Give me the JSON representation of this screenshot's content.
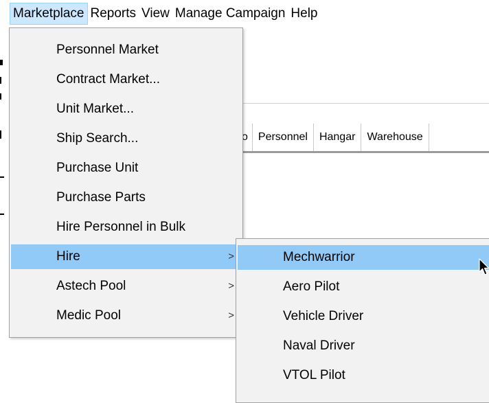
{
  "menubar": {
    "items": [
      {
        "label": "Marketplace",
        "active": true
      },
      {
        "label": "Reports"
      },
      {
        "label": "View"
      },
      {
        "label": "Manage Campaign"
      },
      {
        "label": "Help"
      }
    ]
  },
  "background": {
    "tabs": [
      {
        "label": "o"
      },
      {
        "label": "Personnel"
      },
      {
        "label": "Hangar"
      },
      {
        "label": "Warehouse"
      }
    ]
  },
  "marketplace_menu": {
    "items": [
      {
        "label": "Personnel Market"
      },
      {
        "label": "Contract Market..."
      },
      {
        "label": "Unit Market..."
      },
      {
        "label": "Ship Search..."
      },
      {
        "label": "Purchase Unit"
      },
      {
        "label": "Purchase Parts"
      },
      {
        "label": "Hire Personnel in Bulk"
      },
      {
        "label": "Hire",
        "arrow": ">"
      },
      {
        "label": "Astech Pool",
        "arrow": ">"
      },
      {
        "label": "Medic Pool",
        "arrow": ">"
      }
    ]
  },
  "hire_submenu": {
    "items": [
      {
        "label": "Mechwarrior"
      },
      {
        "label": "Aero Pilot"
      },
      {
        "label": "Vehicle Driver"
      },
      {
        "label": "Naval Driver"
      },
      {
        "label": "VTOL Pilot"
      }
    ]
  },
  "colors": {
    "menu_bg": "#f2f2f2",
    "highlight": "#91c9f7",
    "menubar_active_bg": "#cce8ff"
  }
}
